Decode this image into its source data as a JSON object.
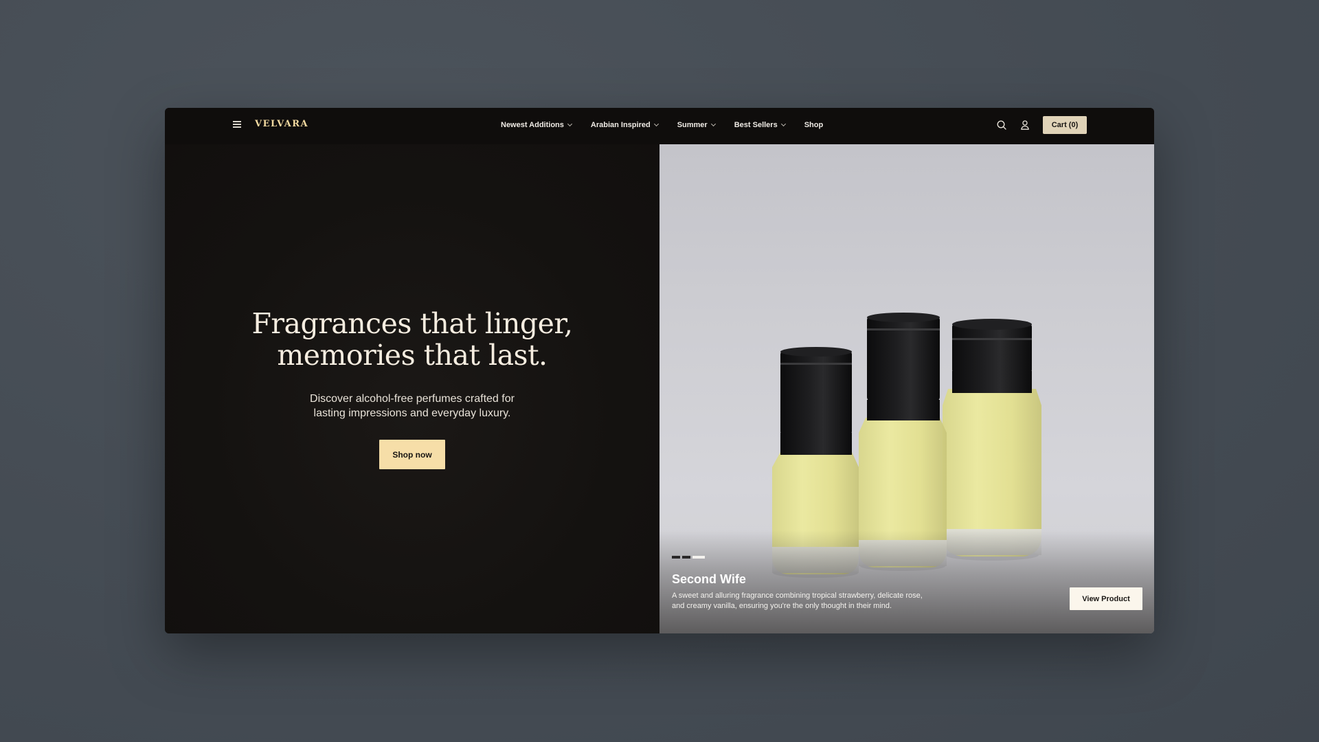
{
  "brand": {
    "name": "VELVARA",
    "accent_color": "#f2d9a0"
  },
  "header": {
    "menu_icon": "hamburger-menu-icon",
    "nav": [
      {
        "label": "Newest Additions",
        "has_dropdown": true
      },
      {
        "label": "Arabian Inspired",
        "has_dropdown": true
      },
      {
        "label": "Summer",
        "has_dropdown": true
      },
      {
        "label": "Best Sellers",
        "has_dropdown": true
      },
      {
        "label": "Shop",
        "has_dropdown": false
      }
    ],
    "search_icon": "search-icon",
    "account_icon": "user-icon",
    "cart_label": "Cart (0)"
  },
  "hero": {
    "headline_line1": "Fragrances that linger,",
    "headline_line2": "memories that last.",
    "subtext_line1": "Discover alcohol-free perfumes crafted for",
    "subtext_line2": "lasting impressions and everyday luxury.",
    "cta_label": "Shop now",
    "cta_color": "#f6dea8"
  },
  "slider": {
    "slide_count": 3,
    "active_index": 2,
    "product_title": "Second Wife",
    "product_desc_line1": "A sweet and alluring fragrance combining tropical strawberry, delicate rose,",
    "product_desc_line2": "and creamy vanilla, ensuring you're the only thought in their mind.",
    "cta_label": "View Product"
  }
}
